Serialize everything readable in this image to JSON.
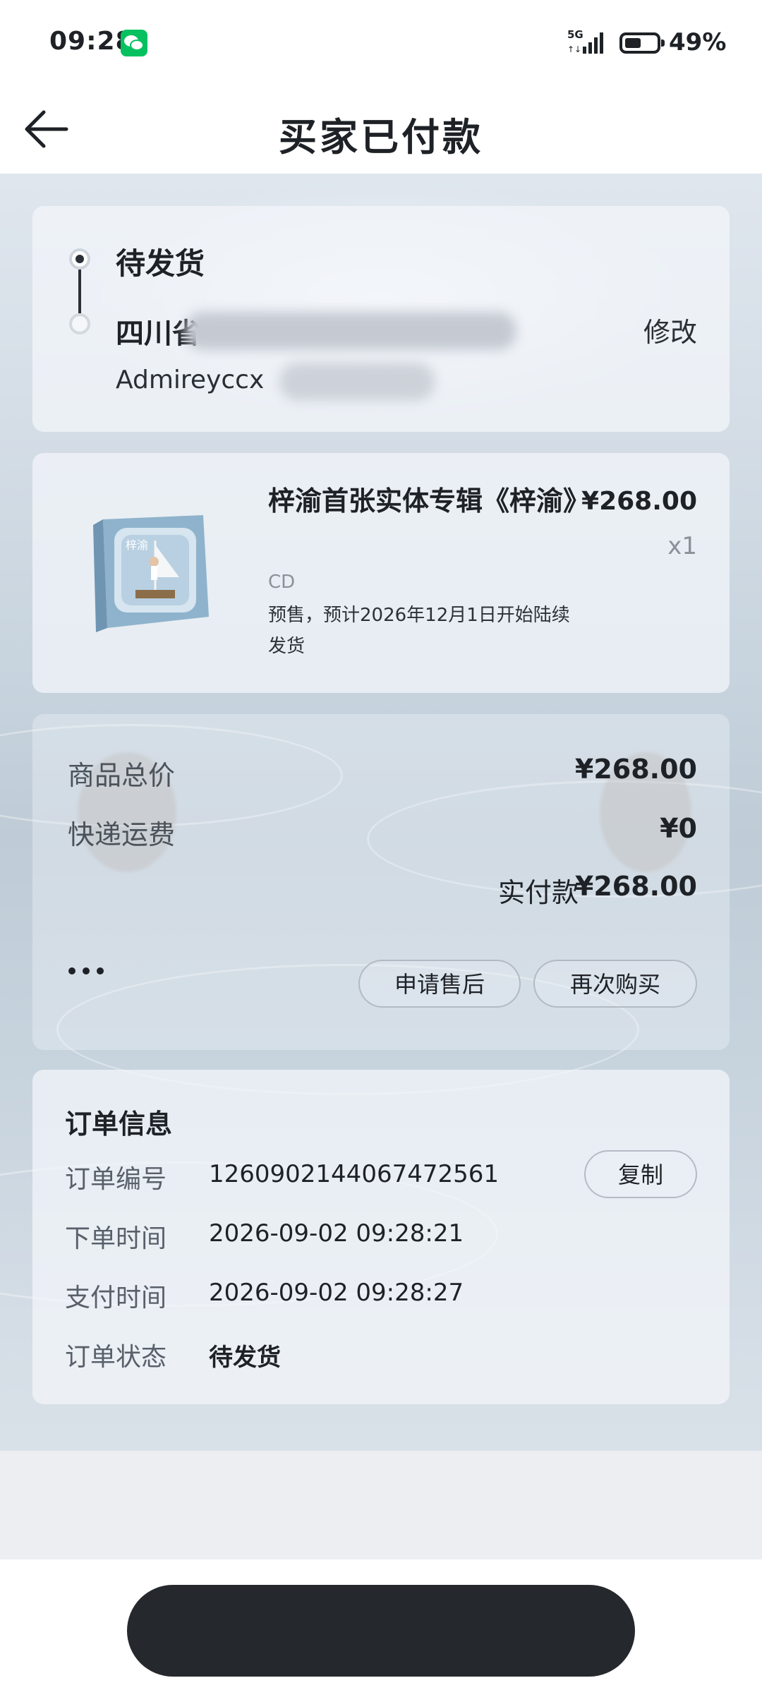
{
  "status_bar": {
    "time": "09:28",
    "network": "5G",
    "battery": "49%",
    "icons": [
      "wechat-icon",
      "signal-icon",
      "battery-icon"
    ]
  },
  "header": {
    "title": "买家已付款",
    "back_icon": "arrow-left-icon"
  },
  "address": {
    "status": "待发货",
    "province": "四川省",
    "recipient": "Admireyccx",
    "edit_label": "修改"
  },
  "product": {
    "name": "梓渝首张实体专辑《梓渝》",
    "price": "¥268.00",
    "quantity": "x1",
    "spec": "CD",
    "presale_note": "预售，预计2026年12月1日开始陆续发货"
  },
  "price_summary": {
    "goods_total_label": "商品总价",
    "goods_total": "¥268.00",
    "shipping_label": "快递运费",
    "shipping": "¥0",
    "paid_label": "实付款",
    "paid": "¥268.00",
    "after_sale_label": "申请售后",
    "rebuy_label": "再次购买",
    "more_icon": "more-dots-icon"
  },
  "order_info": {
    "title": "订单信息",
    "order_no_label": "订单编号",
    "order_no": "1260902144067472561",
    "copy_label": "复制",
    "created_label": "下单时间",
    "created": "2026-09-02 09:28:21",
    "paid_time_label": "支付时间",
    "paid_time": "2026-09-02 09:28:27",
    "status_label": "订单状态",
    "status": "待发货"
  },
  "colors": {
    "text": "#1e2226",
    "muted": "#59606a",
    "wechat": "#07c160",
    "bottom_bar": "#25282c"
  }
}
